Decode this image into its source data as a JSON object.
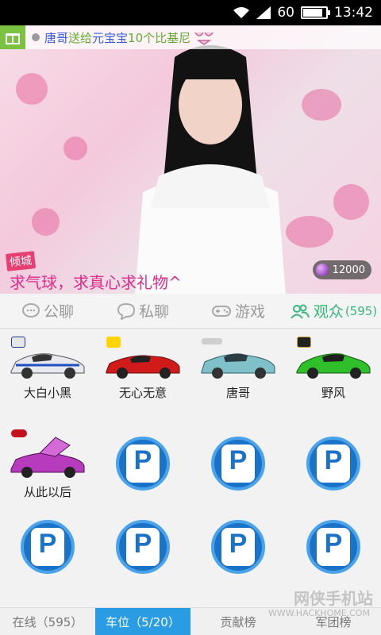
{
  "status": {
    "signal_text": "60",
    "time": "13:42",
    "battery_level": 0.85
  },
  "video": {
    "gift_banner": {
      "sender": "唐哥",
      "verb": "送给",
      "receiver": "元宝宝",
      "item": "10个比基尼"
    },
    "host_tag": "倾城",
    "host_message": "求气球，求真心求礼物^",
    "coins": "12000"
  },
  "tabs": [
    {
      "label": "公聊",
      "icon": "chat-bubble-icon"
    },
    {
      "label": "私聊",
      "icon": "private-chat-icon"
    },
    {
      "label": "游戏",
      "icon": "gamepad-icon"
    },
    {
      "label": "观众",
      "count": "(595)",
      "icon": "audience-icon"
    }
  ],
  "parking": {
    "cars": [
      {
        "owner": "大白小黑",
        "brand": "maserati",
        "color": "#e8e8ef"
      },
      {
        "owner": "无心无意",
        "brand": "ferrari",
        "color": "#d11a1a"
      },
      {
        "owner": "唐哥",
        "brand": "aston-martin",
        "color": "#7fc0c9"
      },
      {
        "owner": "野风",
        "brand": "lamborghini",
        "color": "#2fbf2a"
      },
      {
        "owner": "从此以后",
        "brand": "bugatti",
        "color": "#b63bbd"
      }
    ],
    "empty_slot_icon": "parking-icon",
    "empty_slot_label": "P"
  },
  "bottom_tabs": [
    {
      "label": "在线（595）"
    },
    {
      "label": "车位（5/20）"
    },
    {
      "label": "贡献榜"
    },
    {
      "label": "军团榜"
    }
  ],
  "watermark": {
    "brand": "网侠手机站",
    "url": "WWW.HACKHOME.COM"
  }
}
